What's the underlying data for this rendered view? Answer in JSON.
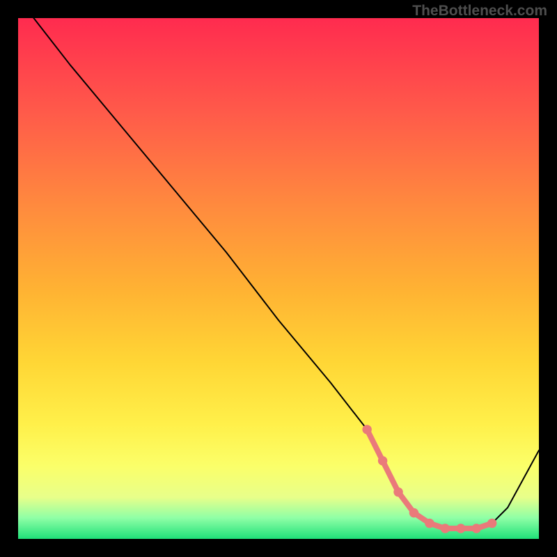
{
  "watermark": "TheBottleneck.com",
  "chart_data": {
    "type": "line",
    "title": "",
    "xlabel": "",
    "ylabel": "",
    "xlim": [
      0,
      100
    ],
    "ylim": [
      0,
      100
    ],
    "grid": false,
    "legend": false,
    "annotations": [],
    "series": [
      {
        "name": "black-curve",
        "color": "#000000",
        "x": [
          3,
          10,
          20,
          30,
          40,
          50,
          60,
          67,
          70,
          73,
          76,
          79,
          82,
          85,
          88,
          91,
          94,
          100
        ],
        "y": [
          100,
          91,
          79,
          67,
          55,
          42,
          30,
          21,
          15,
          9,
          5,
          3,
          2,
          2,
          2,
          3,
          6,
          17
        ]
      },
      {
        "name": "pink-highlight",
        "color": "#ea7a7a",
        "x": [
          67,
          70,
          73,
          76,
          79,
          82,
          85,
          88,
          91
        ],
        "y": [
          21,
          15,
          9,
          5,
          3,
          2,
          2,
          2,
          3
        ],
        "style": "thick-dots"
      }
    ]
  }
}
